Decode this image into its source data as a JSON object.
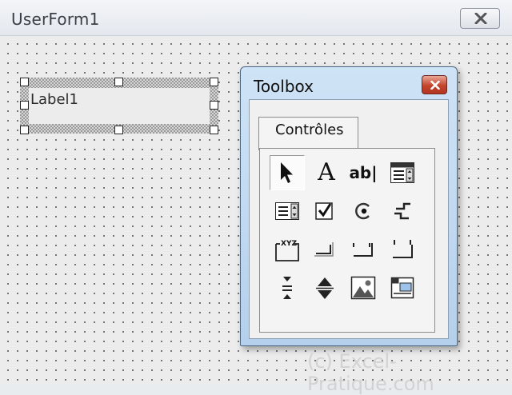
{
  "userform": {
    "title": "UserForm1",
    "label_control": {
      "caption": "Label1"
    }
  },
  "toolbox": {
    "title": "Toolbox",
    "tab": "Contrôles",
    "tools": [
      {
        "name": "pointer",
        "selected": true
      },
      {
        "name": "label",
        "glyph": "A"
      },
      {
        "name": "textbox",
        "glyph": "ab|"
      },
      {
        "name": "combobox"
      },
      {
        "name": "listbox"
      },
      {
        "name": "checkbox"
      },
      {
        "name": "optionbutton"
      },
      {
        "name": "togglebutton"
      },
      {
        "name": "frame",
        "glyph": "XYZ"
      },
      {
        "name": "commandbutton"
      },
      {
        "name": "tabstrip"
      },
      {
        "name": "multipage"
      },
      {
        "name": "scrollbar"
      },
      {
        "name": "spinbutton"
      },
      {
        "name": "image"
      },
      {
        "name": "refedit"
      }
    ]
  },
  "watermark": "(c) Excel-Pratique.com"
}
